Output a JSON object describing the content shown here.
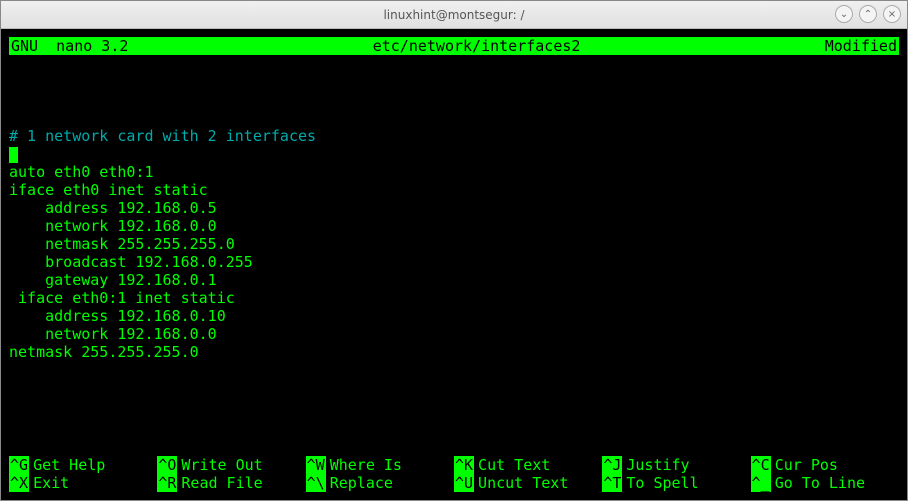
{
  "window": {
    "title": "linuxhint@montsegur: /"
  },
  "nano": {
    "version": "GNU  nano 3.2",
    "filename": "etc/network/interfaces2",
    "status": "Modified"
  },
  "content": {
    "comment": "# 1 network card with 2 interfaces",
    "lines": [
      "auto eth0 eth0:1",
      "iface eth0 inet static",
      "    address 192.168.0.5",
      "    network 192.168.0.0",
      "    netmask 255.255.255.0",
      "    broadcast 192.168.0.255",
      "    gateway 192.168.0.1",
      " iface eth0:1 inet static",
      "    address 192.168.0.10",
      "    network 192.168.0.0",
      "netmask 255.255.255.0"
    ]
  },
  "shortcuts": {
    "row1": [
      {
        "key": "^G",
        "label": "Get Help"
      },
      {
        "key": "^O",
        "label": "Write Out"
      },
      {
        "key": "^W",
        "label": "Where Is"
      },
      {
        "key": "^K",
        "label": "Cut Text"
      },
      {
        "key": "^J",
        "label": "Justify"
      },
      {
        "key": "^C",
        "label": "Cur Pos"
      }
    ],
    "row2": [
      {
        "key": "^X",
        "label": "Exit"
      },
      {
        "key": "^R",
        "label": "Read File"
      },
      {
        "key": "^\\",
        "label": "Replace"
      },
      {
        "key": "^U",
        "label": "Uncut Text"
      },
      {
        "key": "^T",
        "label": "To Spell"
      },
      {
        "key": "^_",
        "label": "Go To Line"
      }
    ]
  },
  "controls": {
    "minimize": "⌄",
    "maximize": "⌃",
    "close": "×"
  }
}
